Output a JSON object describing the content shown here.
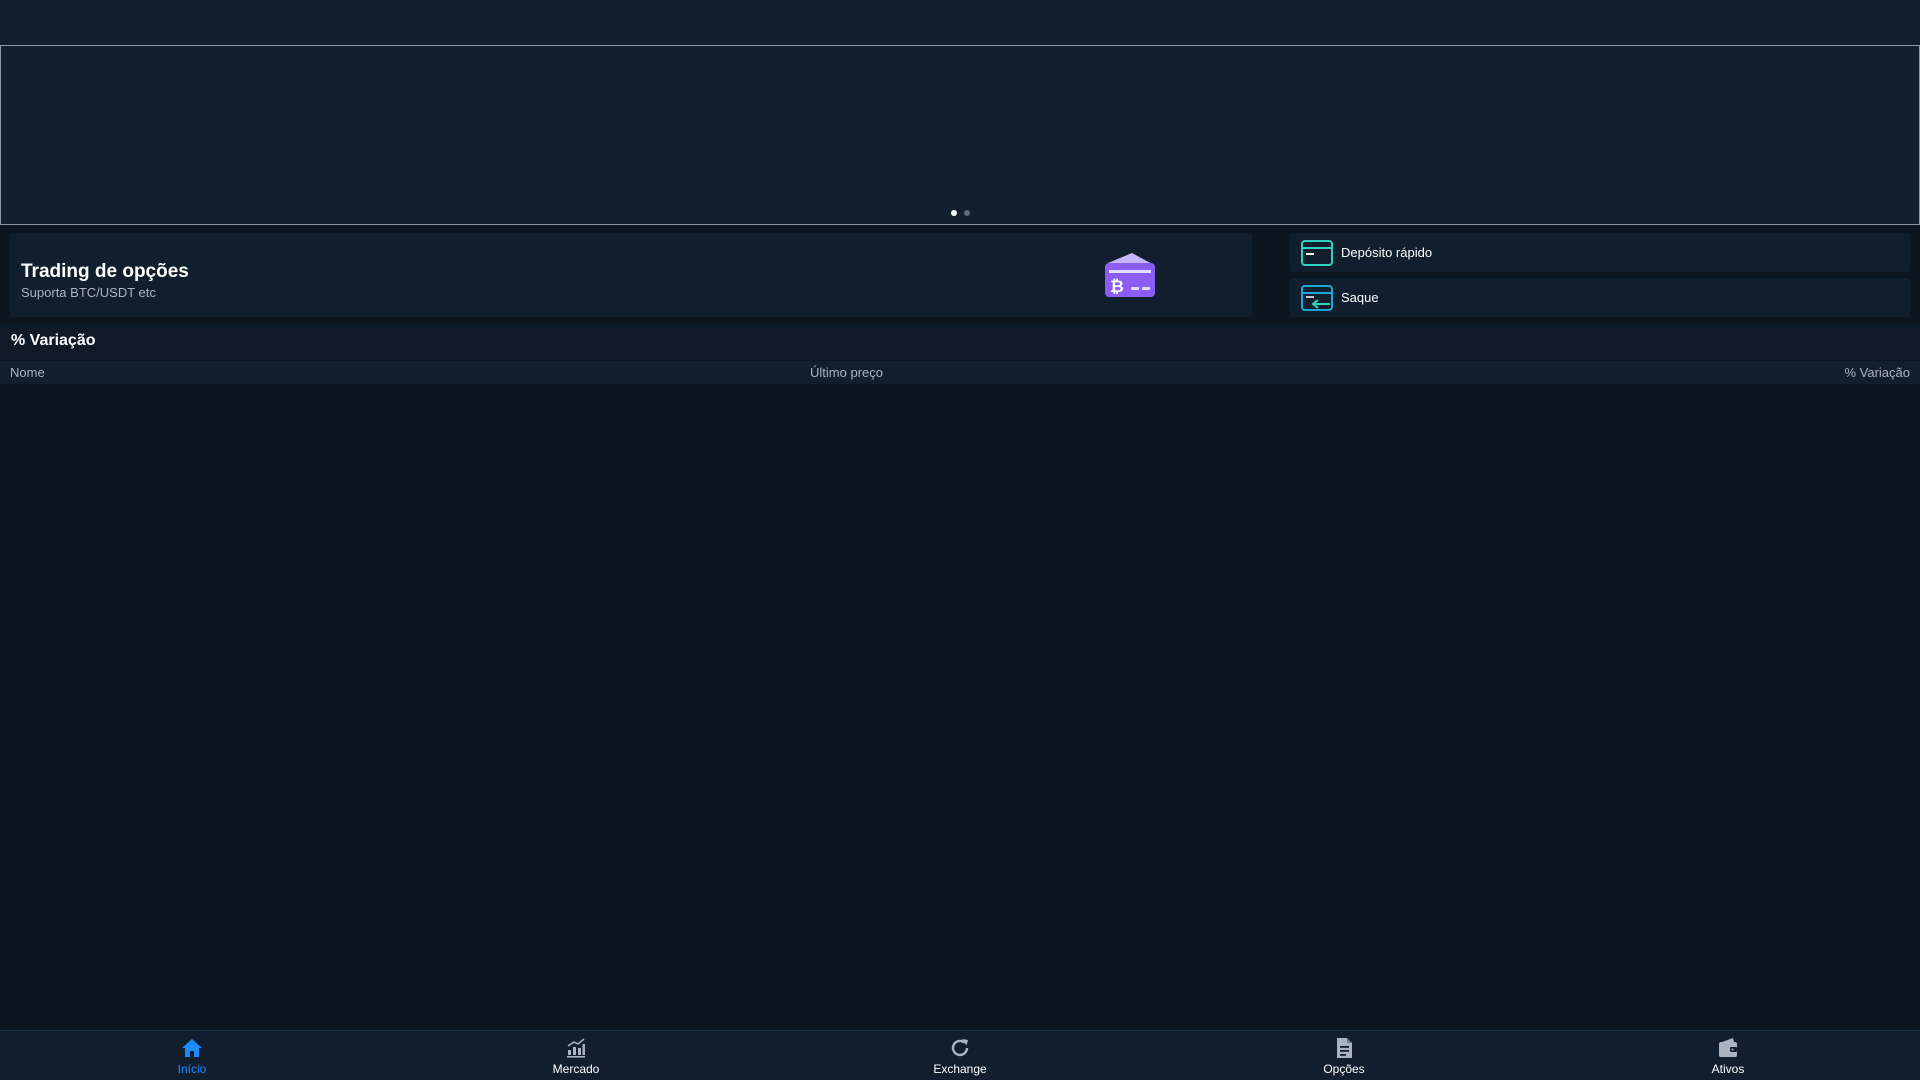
{
  "banner": {
    "slides": 2,
    "active_slide": 1
  },
  "options_card": {
    "title": "Trading de opções",
    "subtitle": "Suporta BTC/USDT etc",
    "icon": "bitcoin-card-icon"
  },
  "quick_actions": {
    "deposit_label": "Depósito rápido",
    "deposit_icon": "credit-card-icon",
    "withdraw_label": "Saque",
    "withdraw_icon": "card-transfer-icon"
  },
  "market": {
    "section_title": "% Variação",
    "columns": {
      "name": "Nome",
      "last_price": "Último preço",
      "change": "% Variação"
    },
    "rows": []
  },
  "bottom_nav": {
    "items": [
      {
        "label": "Início",
        "icon": "home-icon",
        "active": true
      },
      {
        "label": "Mercado",
        "icon": "bar-chart-icon",
        "active": false
      },
      {
        "label": "Exchange",
        "icon": "refresh-icon",
        "active": false
      },
      {
        "label": "Opções",
        "icon": "document-icon",
        "active": false
      },
      {
        "label": "Ativos",
        "icon": "wallet-icon",
        "active": false
      }
    ]
  },
  "colors": {
    "background": "#0c1520",
    "panel": "#111e2d",
    "accent": "#1e8cff",
    "teal": "#2ed3c0",
    "purple": "#8b5cf6"
  }
}
